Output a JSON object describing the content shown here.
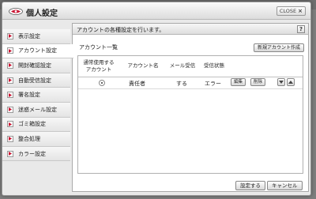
{
  "window": {
    "title": "個人設定",
    "close_label": "CLOSE"
  },
  "sidebar": {
    "items": [
      {
        "label": "表示設定"
      },
      {
        "label": "アカウント設定"
      },
      {
        "label": "開封確認設定"
      },
      {
        "label": "自動受信設定"
      },
      {
        "label": "署名設定"
      },
      {
        "label": "迷惑メール設定"
      },
      {
        "label": "ゴミ箱設定"
      },
      {
        "label": "整合処理"
      },
      {
        "label": "カラー設定"
      }
    ],
    "active_index": 1
  },
  "panel": {
    "title": "アカウントの各種設定を行います。",
    "help_label": "?",
    "list_label": "アカウント一覧",
    "new_account_button": "新規アカウント作成",
    "table": {
      "headers": {
        "default_account": "通常使用する\nアカウント",
        "account_name": "アカウント名",
        "mail_receive": "メール受信",
        "receive_status": "受信状態"
      },
      "rows": [
        {
          "account_name": "責任者",
          "mail_receive": "する",
          "receive_status": "エラー",
          "edit_label": "編集",
          "delete_label": "削除"
        }
      ]
    },
    "save_button": "設定する",
    "cancel_button": "キャンセル"
  },
  "colors": {
    "window_bg": "#e9e9e9",
    "panel_bg": "#ffffff",
    "logo_red": "#c8102e"
  }
}
